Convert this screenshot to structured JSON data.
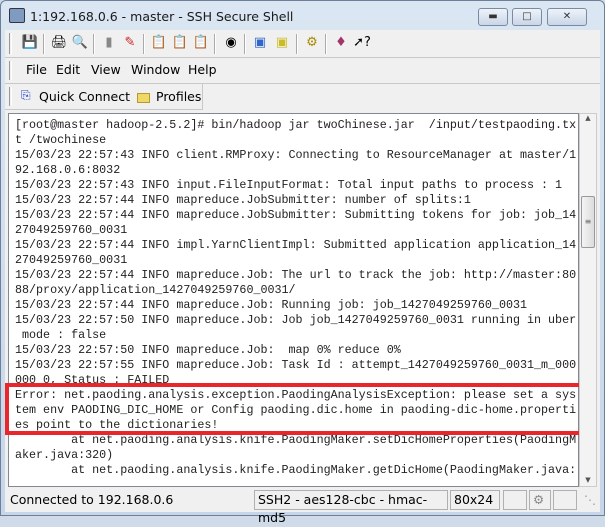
{
  "window": {
    "title": "1:192.168.0.6 - master - SSH Secure Shell",
    "controls": [
      "minimize",
      "maximize",
      "close"
    ]
  },
  "toolbar": {
    "icons": [
      "save-icon",
      "print-icon",
      "print-preview-icon",
      "disconnect-icon",
      "settings-icon",
      "copy-icon",
      "paste-icon",
      "paste-disabled-icon",
      "find-icon",
      "new-terminal-icon",
      "new-file-transfer-icon",
      "keygen-icon",
      "help-book-icon",
      "context-help-icon"
    ]
  },
  "menu": {
    "items": [
      "File",
      "Edit",
      "View",
      "Window",
      "Help"
    ]
  },
  "quickbar": {
    "quick_connect": "Quick Connect",
    "profiles": "Profiles"
  },
  "terminal": {
    "lines": [
      "[root@master hadoop-2.5.2]# bin/hadoop jar twoChinese.jar  /input/testpaoding.tx",
      "t /twochinese",
      "15/03/23 22:57:43 INFO client.RMProxy: Connecting to ResourceManager at master/1",
      "92.168.0.6:8032",
      "15/03/23 22:57:43 INFO input.FileInputFormat: Total input paths to process : 1",
      "15/03/23 22:57:44 INFO mapreduce.JobSubmitter: number of splits:1",
      "15/03/23 22:57:44 INFO mapreduce.JobSubmitter: Submitting tokens for job: job_14",
      "27049259760_0031",
      "15/03/23 22:57:44 INFO impl.YarnClientImpl: Submitted application application_14",
      "27049259760_0031",
      "15/03/23 22:57:44 INFO mapreduce.Job: The url to track the job: http://master:80",
      "88/proxy/application_1427049259760_0031/",
      "15/03/23 22:57:44 INFO mapreduce.Job: Running job: job_1427049259760_0031",
      "15/03/23 22:57:50 INFO mapreduce.Job: Job job_1427049259760_0031 running in uber",
      " mode : false",
      "15/03/23 22:57:50 INFO mapreduce.Job:  map 0% reduce 0%",
      "15/03/23 22:57:55 INFO mapreduce.Job: Task Id : attempt_1427049259760_0031_m_000",
      "000_0, Status : FAILED",
      "Error: net.paoding.analysis.exception.PaodingAnalysisException: please set a sys",
      "tem env PAODING_DIC_HOME or Config paoding.dic.home in paoding-dic-home.properti",
      "es point to the dictionaries!",
      "        at net.paoding.analysis.knife.PaodingMaker.setDicHomeProperties(PaodingM",
      "aker.java:320)",
      "        at net.paoding.analysis.knife.PaodingMaker.getDicHome(PaodingMaker.java:"
    ]
  },
  "highlight_color": "#e8262b",
  "status": {
    "connection": "Connected to 192.168.0.6",
    "cipher": "SSH2 - aes128-cbc - hmac-md5",
    "size": "80x24"
  }
}
